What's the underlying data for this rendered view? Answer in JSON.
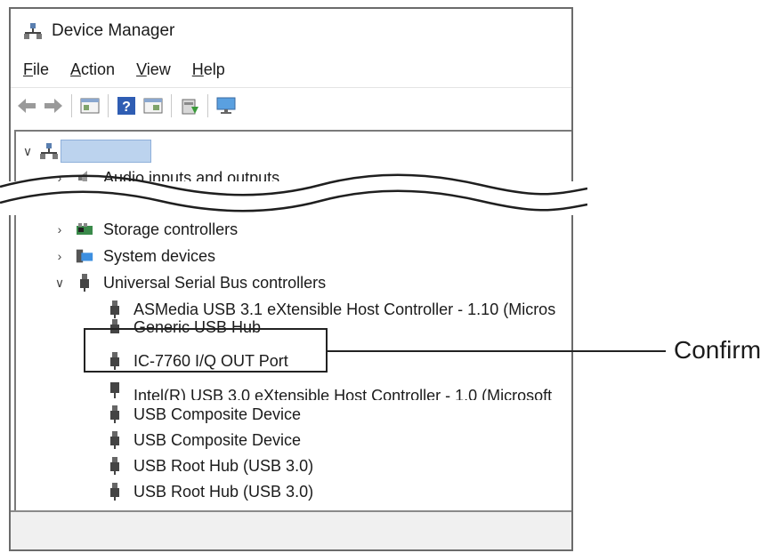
{
  "window": {
    "title": "Device Manager"
  },
  "menu": [
    {
      "first": "F",
      "rest": "ile"
    },
    {
      "first": "A",
      "rest": "ction"
    },
    {
      "first": "V",
      "rest": "iew"
    },
    {
      "first": "H",
      "rest": "elp"
    }
  ],
  "toolbar": {
    "icons": [
      "back-arrow-icon",
      "forward-arrow-icon",
      "properties-icon",
      "help-icon",
      "show-hidden-icon",
      "update-driver-icon",
      "scan-hardware-icon"
    ]
  },
  "tree": {
    "root_label": "",
    "audio": "Audio inputs and outputs",
    "storage": "Storage controllers",
    "system": "System devices",
    "usb_group": "Universal Serial Bus controllers",
    "usb_children": [
      "ASMedia USB 3.1 eXtensible Host Controller - 1.10 (Micros",
      "Generic USB Hub",
      "IC-7760 I/Q OUT Port",
      "Intel(R) USB 3.0 eXtensible Host Controller - 1.0 (Microsoft",
      "USB Composite Device",
      "USB Composite Device",
      "USB Root Hub (USB 3.0)",
      "USB Root Hub (USB 3.0)"
    ]
  },
  "callout": {
    "label": "Confirm"
  }
}
